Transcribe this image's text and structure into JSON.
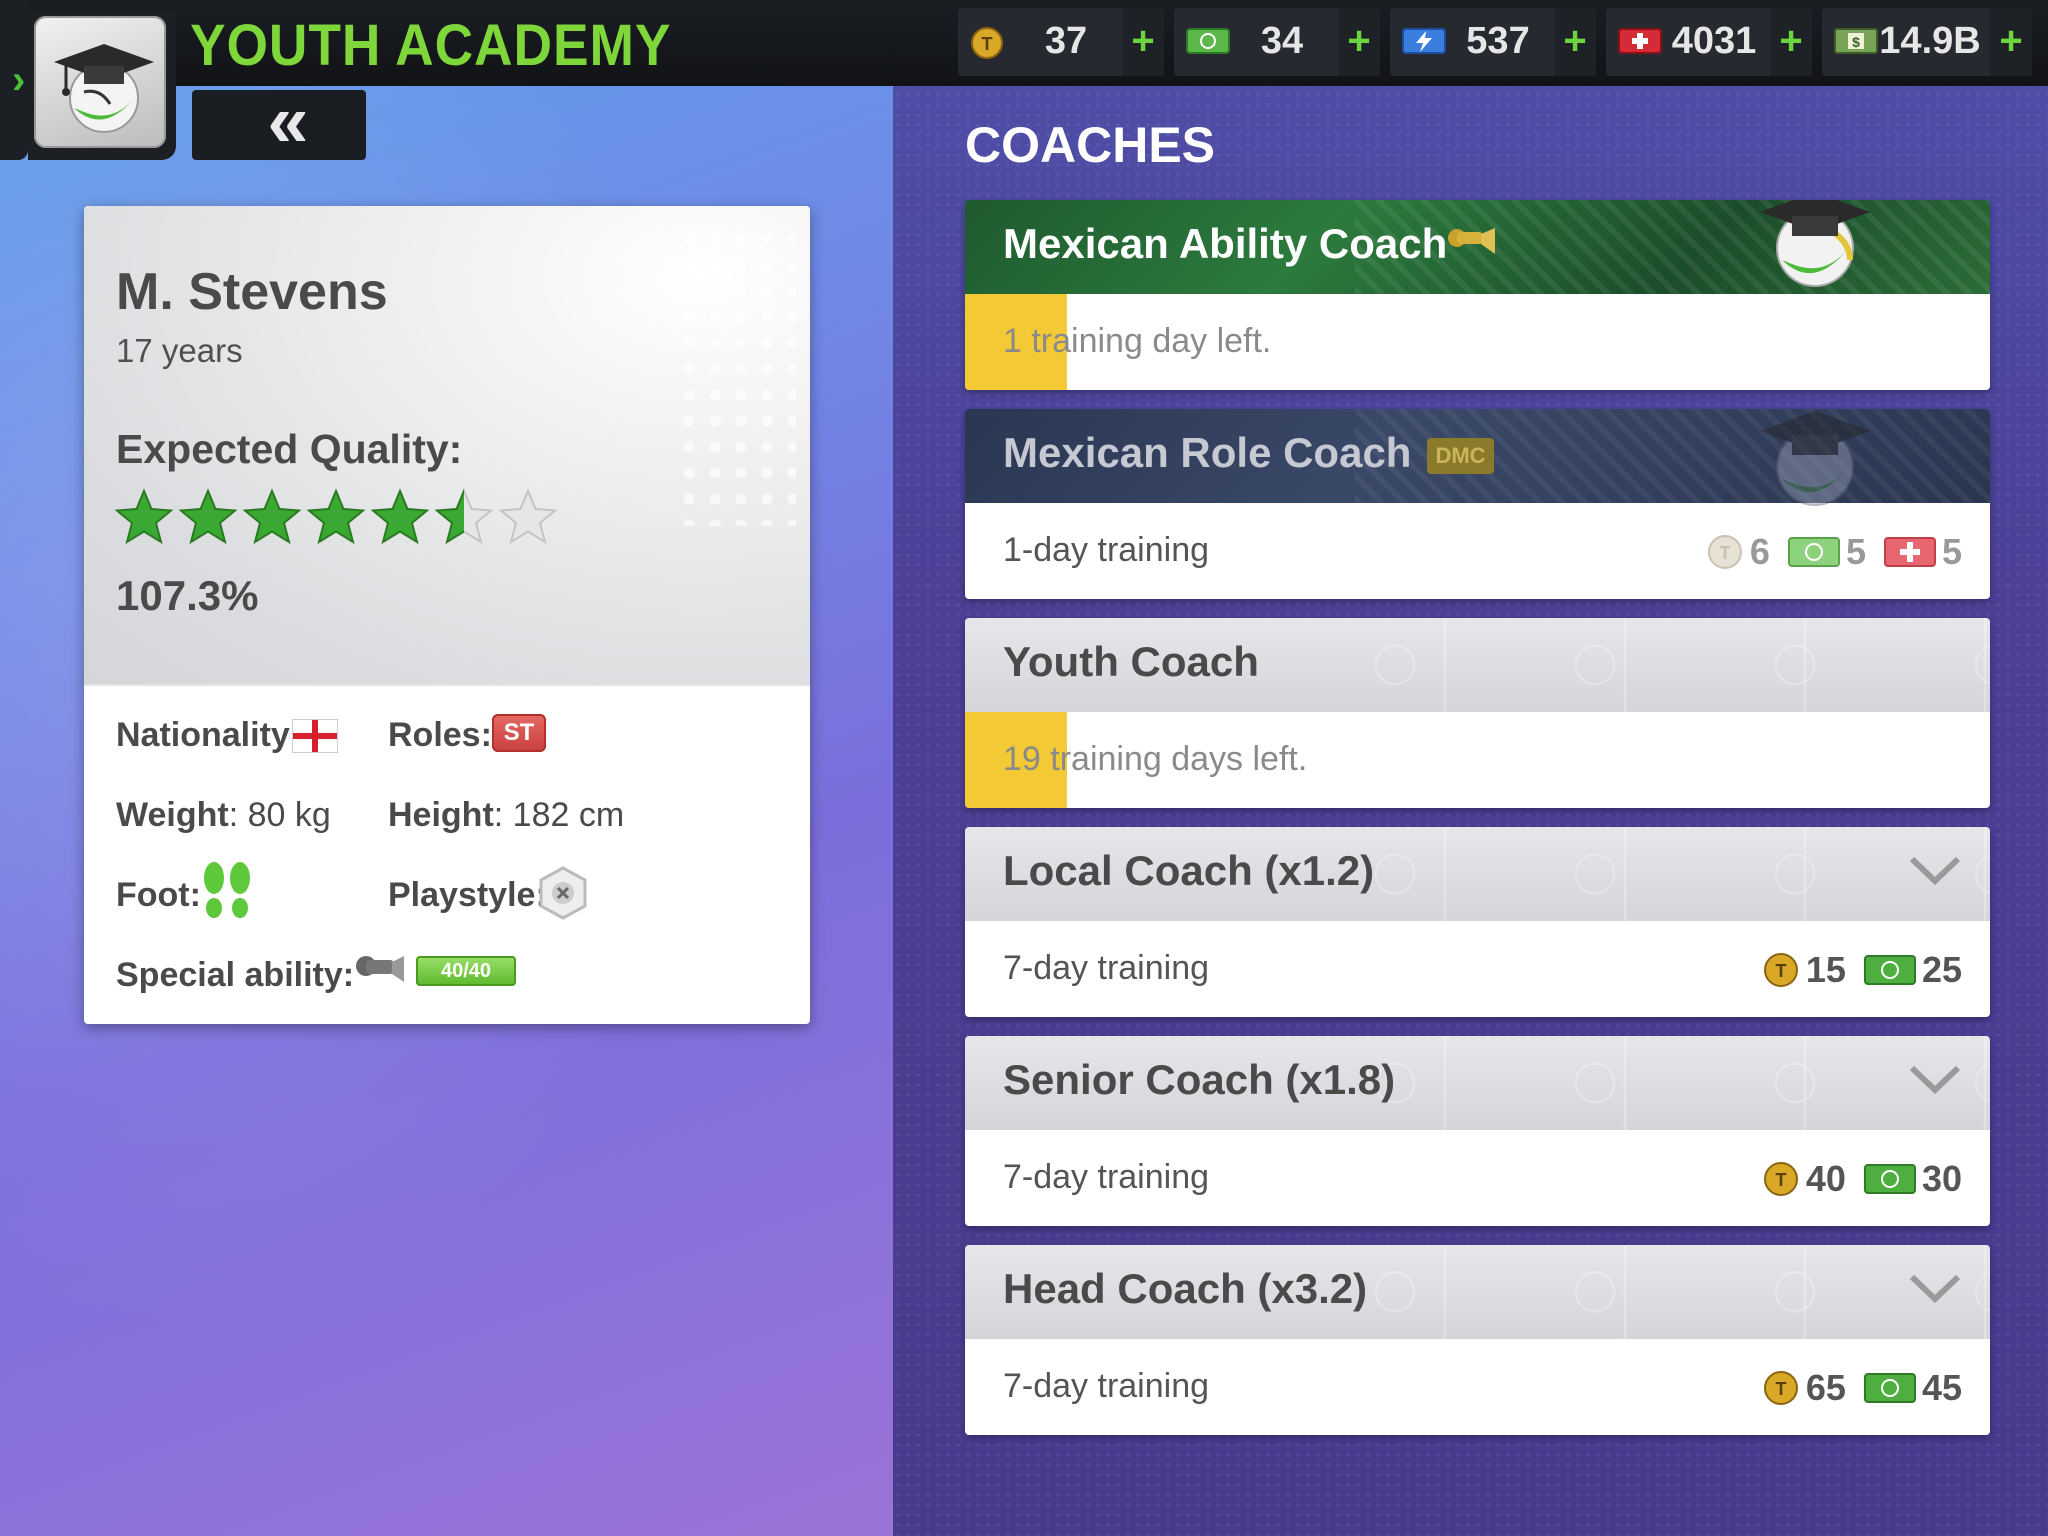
{
  "header": {
    "title": "YOUTH ACADEMY",
    "back_label": "«"
  },
  "resources": [
    {
      "icon": "token-coin-icon",
      "value": "37",
      "plus": "+"
    },
    {
      "icon": "cash-icon",
      "value": "34",
      "plus": "+"
    },
    {
      "icon": "energy-icon",
      "value": "537",
      "plus": "+"
    },
    {
      "icon": "medical-icon",
      "value": "4031",
      "plus": "+"
    },
    {
      "icon": "money-stack-icon",
      "value": "14.9B",
      "plus": "+"
    }
  ],
  "player": {
    "name": "M. Stevens",
    "age": "17 years",
    "expected_quality_label": "Expected Quality:",
    "stars": 5.5,
    "stars_total": 7,
    "quality_pct": "107.3%",
    "nationality_label": "Nationality:",
    "roles_label": "Roles:",
    "role": "ST",
    "weight_label": "Weight",
    "weight_value": ": 80 kg",
    "height_label": "Height",
    "height_value": ": 182 cm",
    "foot_label": "Foot:",
    "playstyle_label": "Playstyle:",
    "special_ability_label": "Special ability:",
    "special_ability_value": "40/40"
  },
  "coaches": {
    "title": "COACHES",
    "items": [
      {
        "name": "Mexican Ability Coach",
        "sub": "1 training day left."
      },
      {
        "name": "Mexican Role Coach",
        "tag": "DMC",
        "sub": "1-day training",
        "costs": [
          "6",
          "5",
          "5"
        ]
      },
      {
        "name": "Youth Coach",
        "sub": "19 training days left."
      },
      {
        "name": "Local Coach (x1.2)",
        "sub": "7-day training",
        "costs": [
          "15",
          "25"
        ]
      },
      {
        "name": "Senior Coach (x1.8)",
        "sub": "7-day training",
        "costs": [
          "40",
          "30"
        ]
      },
      {
        "name": "Head Coach (x3.2)",
        "sub": "7-day training",
        "costs": [
          "65",
          "45"
        ]
      }
    ]
  },
  "colors": {
    "title_green": "#7fd63a",
    "progress_yellow": "#f4c936",
    "plus_green": "#6cd43c",
    "star_green": "#3aa832"
  }
}
